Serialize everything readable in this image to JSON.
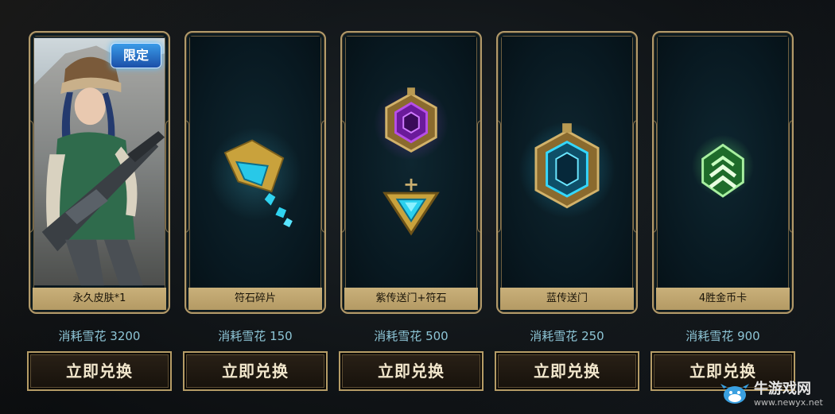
{
  "items": [
    {
      "name": "永久皮肤*1",
      "cost": "消耗雪花 3200",
      "button": "立即兑换",
      "badge": "限定",
      "icon": "skin-portrait"
    },
    {
      "name": "符石碎片",
      "cost": "消耗雪花 150",
      "button": "立即兑换",
      "icon": "rune-shard-icon"
    },
    {
      "name": "紫传送门+符石",
      "cost": "消耗雪花 500",
      "button": "立即兑换",
      "plus": "+",
      "icon": "purple-portal-icon"
    },
    {
      "name": "蓝传送门",
      "cost": "消耗雪花 250",
      "button": "立即兑换",
      "icon": "blue-portal-icon"
    },
    {
      "name": "4胜金币卡",
      "cost": "消耗雪花 900",
      "button": "立即兑换",
      "icon": "gold-card-icon"
    }
  ],
  "watermark": {
    "name": "牛游戏网",
    "url": "www.newyx.net"
  },
  "colors": {
    "gold": "#b29a6a",
    "cost_text": "#8dc5d6",
    "card_bg": "#0b1a20"
  }
}
